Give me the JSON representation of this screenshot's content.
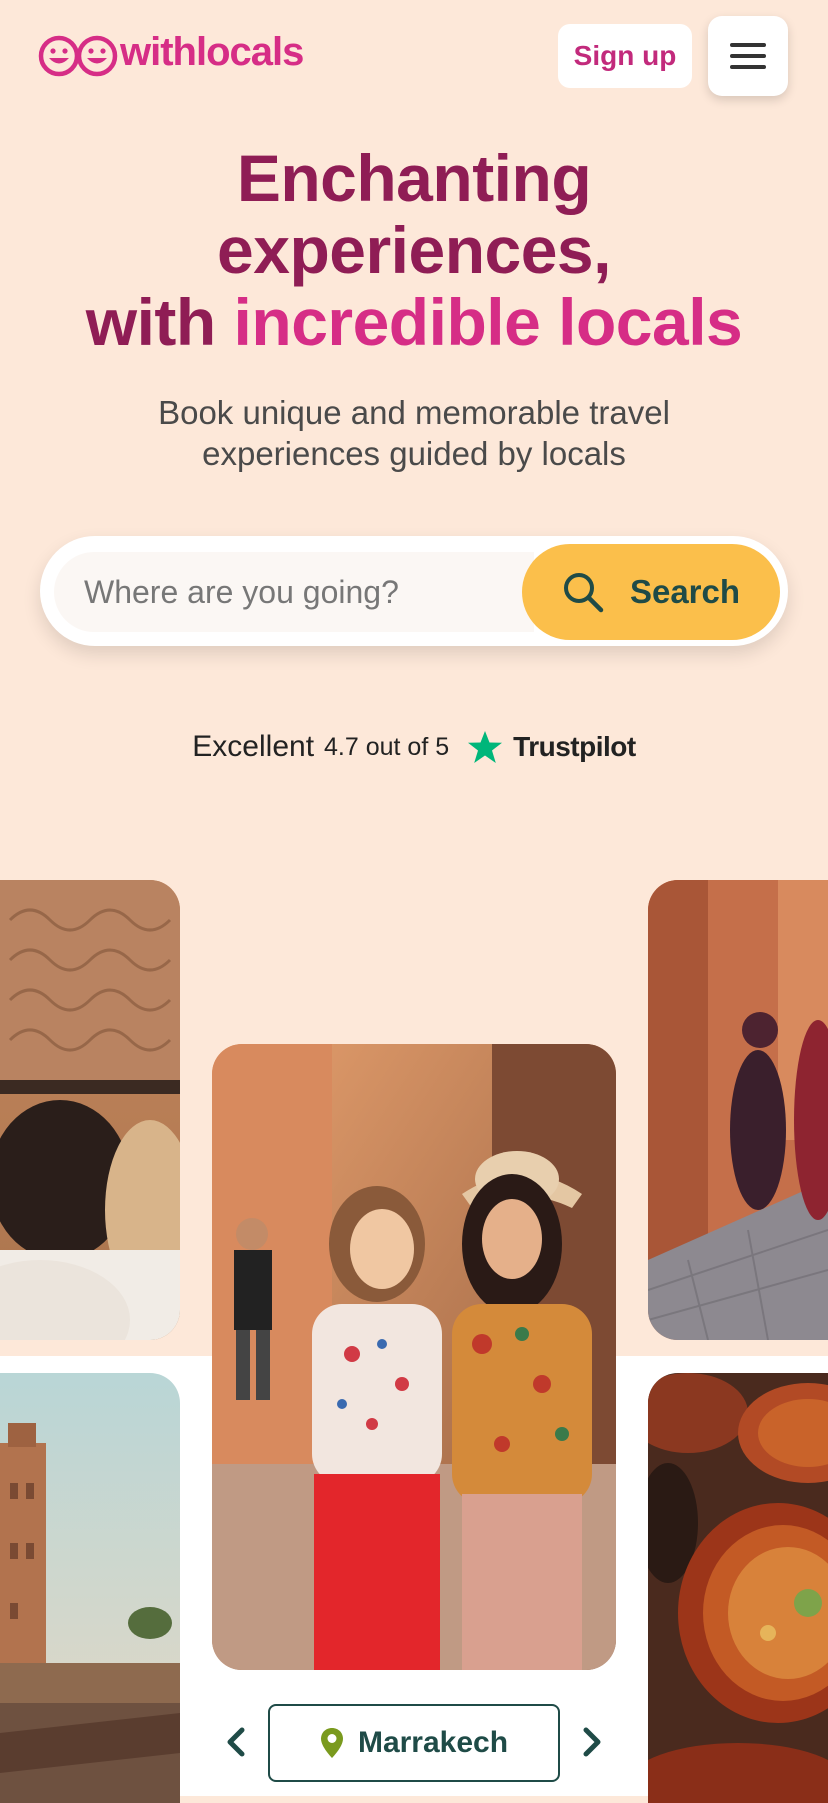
{
  "brand": {
    "name": "withlocals",
    "color": "#d62d86"
  },
  "header": {
    "signup_label": "Sign up"
  },
  "hero": {
    "line1": "Enchanting",
    "line2": "experiences,",
    "line3_prefix": "with",
    "line3_accent": "incredible locals",
    "subtitle": "Book unique and memorable travel experiences guided by locals"
  },
  "search": {
    "placeholder": "Where are you going?",
    "button_label": "Search"
  },
  "trustpilot": {
    "label": "Excellent",
    "rating": "4.7 out of 5",
    "brand": "Trustpilot"
  },
  "carousel": {
    "location": "Marrakech"
  },
  "colors": {
    "background": "#fde8d9",
    "hero_dark": "#8f1d55",
    "hero_accent": "#d62d86",
    "search_button": "#fbbf4b",
    "dark_green": "#1f4b47",
    "trustpilot_star": "#00b67a"
  },
  "icons": {
    "logo": "smiley-faces-icon",
    "menu": "hamburger-menu-icon",
    "search": "search-icon",
    "trustpilot": "star-icon",
    "prev": "chevron-left-icon",
    "next": "chevron-right-icon",
    "location": "map-pin-icon"
  }
}
